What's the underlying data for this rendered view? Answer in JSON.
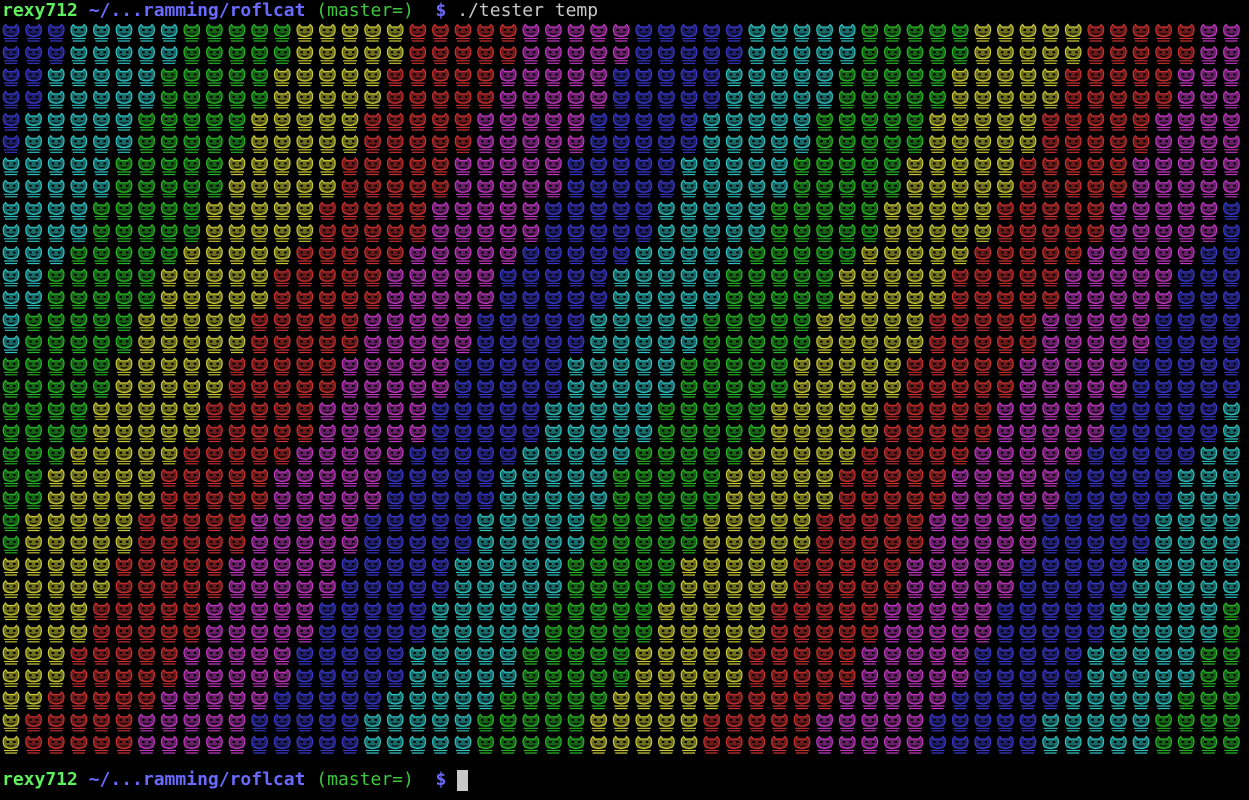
{
  "terminal": {
    "prompt": {
      "user": "rexy712",
      "path": "~/...ramming/roflcat",
      "git": "(master=)",
      "symbol": "$"
    },
    "command": "./tester temp"
  },
  "output": {
    "glyph_icon": "cat-face-icon",
    "palette": [
      "#3838c8",
      "#30c0c0",
      "#28b428",
      "#c8c838",
      "#c83030",
      "#c038c0"
    ]
  }
}
